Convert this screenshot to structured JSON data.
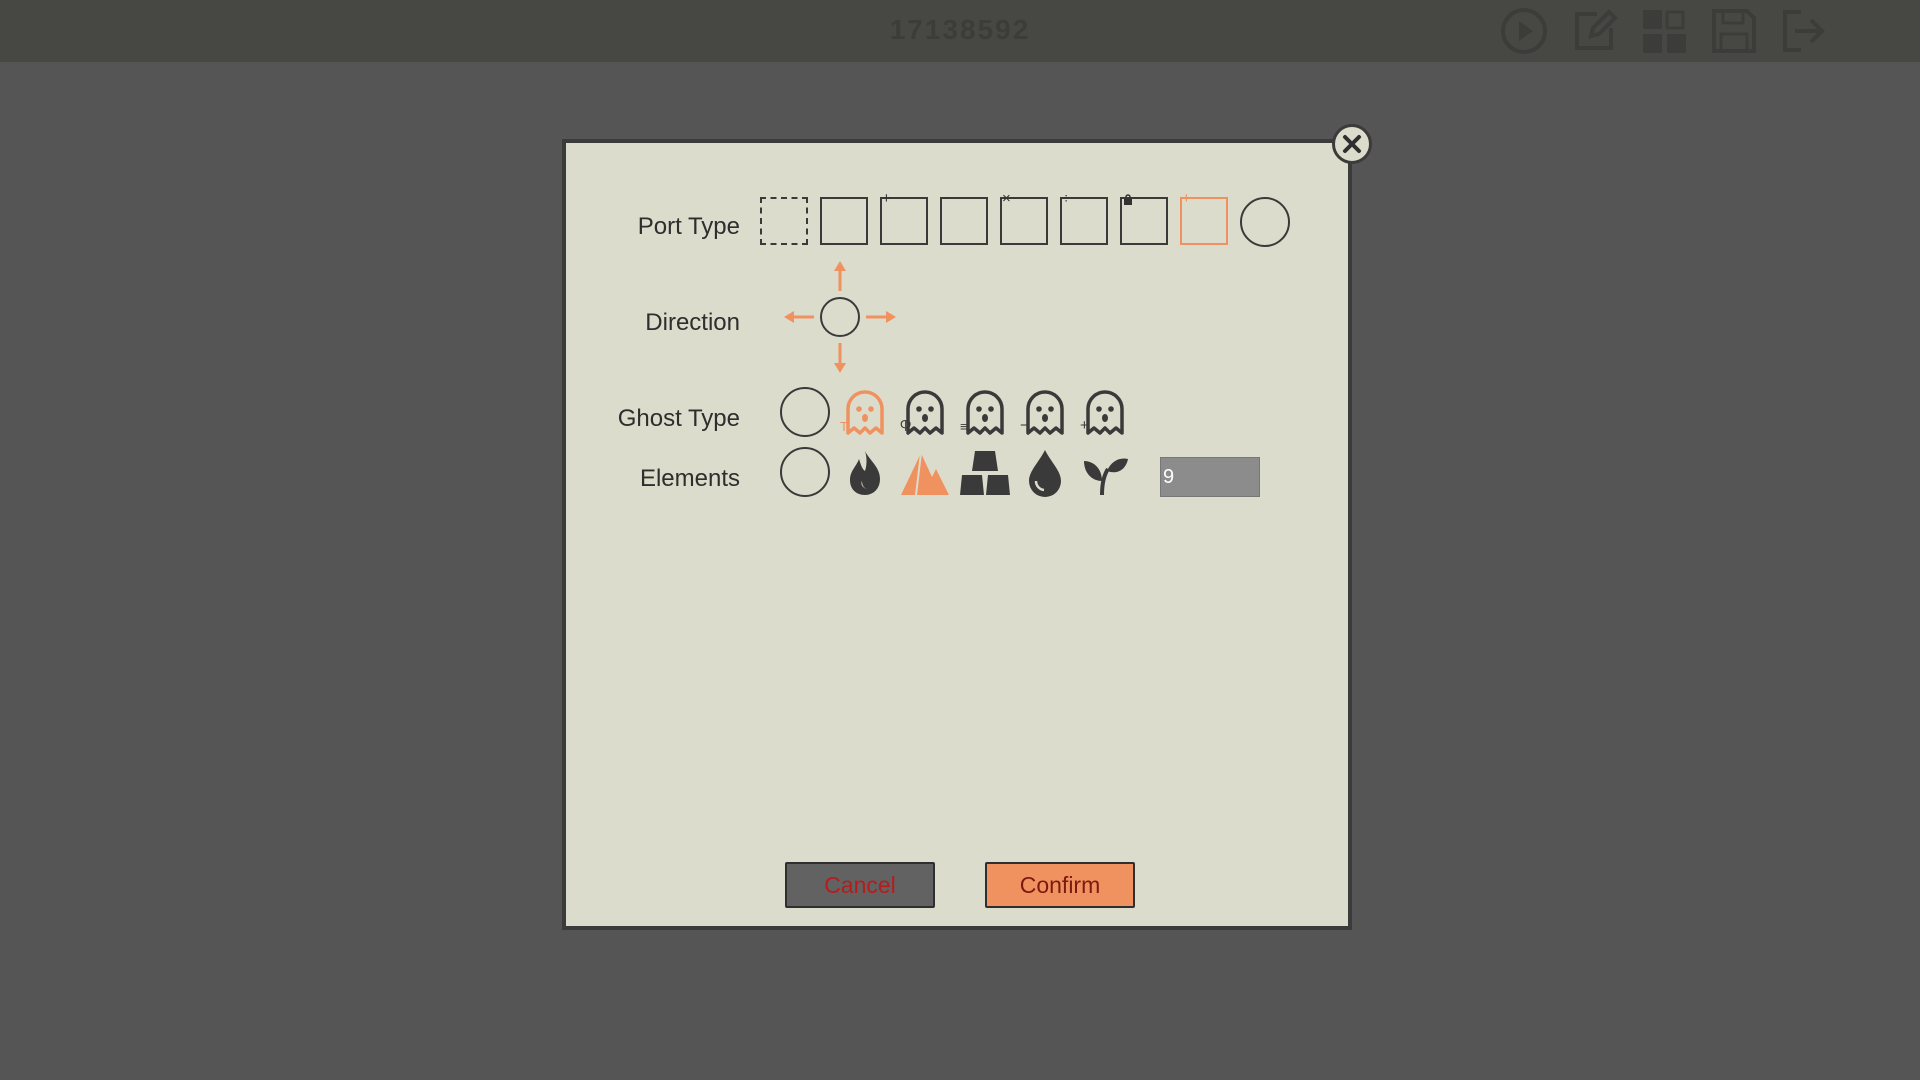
{
  "header": {
    "level_id": "17138592"
  },
  "toolbar": {
    "icons": [
      "play-icon",
      "edit-icon",
      "grid-icon",
      "save-icon",
      "exit-icon"
    ]
  },
  "dialog": {
    "port_type": {
      "label": "Port Type",
      "options": [
        {
          "name": "empty",
          "marker": ""
        },
        {
          "name": "plain",
          "marker": ""
        },
        {
          "name": "add",
          "marker": "+"
        },
        {
          "name": "subtract",
          "marker": "−"
        },
        {
          "name": "multiply",
          "marker": "×"
        },
        {
          "name": "divide",
          "marker": "÷"
        },
        {
          "name": "locked",
          "marker": "🔒"
        },
        {
          "name": "selected",
          "marker": "+"
        },
        {
          "name": "circle",
          "marker": ""
        }
      ],
      "selected_index": 7
    },
    "direction": {
      "label": "Direction",
      "arrows": [
        "up",
        "down",
        "left",
        "right"
      ]
    },
    "ghost_type": {
      "label": "Ghost Type",
      "options": [
        "none",
        "ghost-t",
        "ghost-pi",
        "ghost-eq",
        "ghost-minus",
        "ghost-plus"
      ],
      "markers": [
        "",
        "T",
        "Ⴔ",
        "≡",
        "−",
        "+"
      ],
      "selected_index": 1
    },
    "elements": {
      "label": "Elements",
      "options": [
        "none",
        "fire",
        "mountain",
        "metal",
        "water",
        "plant"
      ],
      "selected_index": 2,
      "value": "9"
    },
    "buttons": {
      "cancel": "Cancel",
      "confirm": "Confirm"
    }
  },
  "colors": {
    "accent": "#ef925f",
    "icon_dark": "#3a3a3a",
    "dialog_bg": "#dcdccc",
    "page_bg": "#555555"
  }
}
